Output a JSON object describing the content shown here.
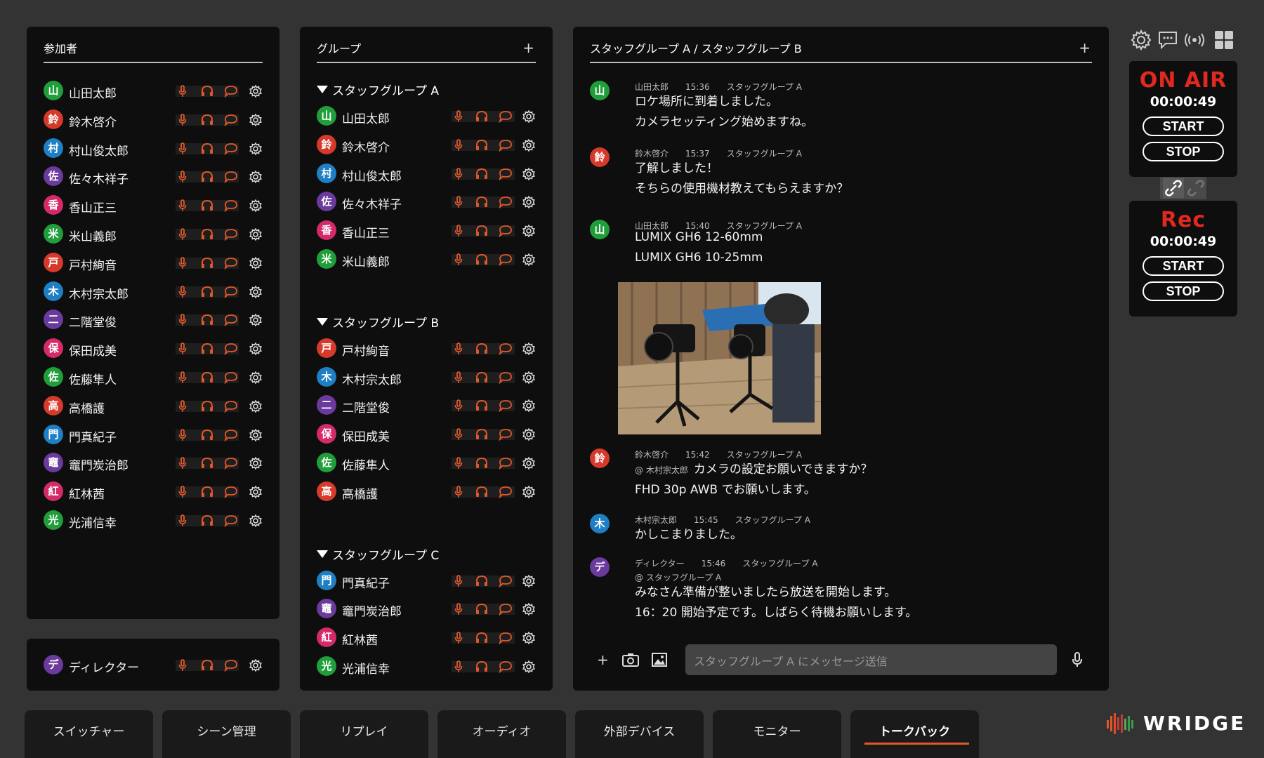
{
  "colors": {
    "accent": "#e0582a",
    "on_air": "#e0291f",
    "panel": "#0e0e0e",
    "bg": "#333333"
  },
  "participants": {
    "title": "参加者",
    "items": [
      {
        "initial": "山",
        "name": "山田太郎",
        "color": "#1f9e3a"
      },
      {
        "initial": "鈴",
        "name": "鈴木啓介",
        "color": "#d63a2a"
      },
      {
        "initial": "村",
        "name": "村山俊太郎",
        "color": "#1f7fc4"
      },
      {
        "initial": "佐",
        "name": "佐々木祥子",
        "color": "#6a3a9c"
      },
      {
        "initial": "香",
        "name": "香山正三",
        "color": "#d42a6a"
      },
      {
        "initial": "米",
        "name": "米山義郎",
        "color": "#1f9e3a"
      },
      {
        "initial": "戸",
        "name": "戸村絢音",
        "color": "#d63a2a"
      },
      {
        "initial": "木",
        "name": "木村宗太郎",
        "color": "#1f7fc4"
      },
      {
        "initial": "二",
        "name": "二階堂俊",
        "color": "#6a3a9c"
      },
      {
        "initial": "保",
        "name": "保田成美",
        "color": "#d42a6a"
      },
      {
        "initial": "佐",
        "name": "佐藤隼人",
        "color": "#1f9e3a"
      },
      {
        "initial": "高",
        "name": "高橋護",
        "color": "#d63a2a"
      },
      {
        "initial": "門",
        "name": "門真紀子",
        "color": "#1f7fc4"
      },
      {
        "initial": "竈",
        "name": "竈門炭治郎",
        "color": "#6a3a9c"
      },
      {
        "initial": "紅",
        "name": "紅林茜",
        "color": "#d42a6a"
      },
      {
        "initial": "光",
        "name": "光浦信幸",
        "color": "#1f9e3a"
      }
    ]
  },
  "director": {
    "initial": "デ",
    "name": "ディレクター",
    "color": "#6a3a9c"
  },
  "groups": {
    "title": "グループ",
    "add": "+",
    "list": [
      {
        "name": "スタッフグループ A",
        "members": [
          {
            "initial": "山",
            "name": "山田太郎",
            "color": "#1f9e3a"
          },
          {
            "initial": "鈴",
            "name": "鈴木啓介",
            "color": "#d63a2a"
          },
          {
            "initial": "村",
            "name": "村山俊太郎",
            "color": "#1f7fc4"
          },
          {
            "initial": "佐",
            "name": "佐々木祥子",
            "color": "#6a3a9c"
          },
          {
            "initial": "香",
            "name": "香山正三",
            "color": "#d42a6a"
          },
          {
            "initial": "米",
            "name": "米山義郎",
            "color": "#1f9e3a"
          }
        ]
      },
      {
        "name": "スタッフグループ B",
        "members": [
          {
            "initial": "戸",
            "name": "戸村絢音",
            "color": "#d63a2a"
          },
          {
            "initial": "木",
            "name": "木村宗太郎",
            "color": "#1f7fc4"
          },
          {
            "initial": "二",
            "name": "二階堂俊",
            "color": "#6a3a9c"
          },
          {
            "initial": "保",
            "name": "保田成美",
            "color": "#d42a6a"
          },
          {
            "initial": "佐",
            "name": "佐藤隼人",
            "color": "#1f9e3a"
          },
          {
            "initial": "高",
            "name": "高橋護",
            "color": "#d63a2a"
          }
        ]
      },
      {
        "name": "スタッフグループ C",
        "members": [
          {
            "initial": "門",
            "name": "門真紀子",
            "color": "#1f7fc4"
          },
          {
            "initial": "竈",
            "name": "竈門炭治郎",
            "color": "#6a3a9c"
          },
          {
            "initial": "紅",
            "name": "紅林茜",
            "color": "#d42a6a"
          },
          {
            "initial": "光",
            "name": "光浦信幸",
            "color": "#1f9e3a"
          }
        ]
      }
    ]
  },
  "chat": {
    "title": "スタッフグループ A / スタッフグループ B",
    "add": "+",
    "messages": [
      {
        "initial": "山",
        "color": "#1f9e3a",
        "sender": "山田太郎",
        "time": "15:36",
        "group": "スタッフグループ A",
        "lines": [
          "ロケ場所に到着しました。",
          "カメラセッティング始めますね。"
        ]
      },
      {
        "initial": "鈴",
        "color": "#d63a2a",
        "sender": "鈴木啓介",
        "time": "15:37",
        "group": "スタッフグループ A",
        "lines": [
          "了解しました！",
          "そちらの使用機材教えてもらえますか？"
        ]
      },
      {
        "initial": "山",
        "color": "#1f9e3a",
        "sender": "山田太郎",
        "time": "15:40",
        "group": "スタッフグループ A",
        "lines": [
          "LUMIX GH6 12-60mm",
          "LUMIX GH6 10-25mm"
        ]
      },
      {
        "initial": "鈴",
        "color": "#d63a2a",
        "sender": "鈴木啓介",
        "time": "15:42",
        "group": "スタッフグループ A",
        "mention": "@ 木村宗太郎",
        "lines": [
          "カメラの設定お願いできますか？",
          "FHD 30p AWB でお願いします。"
        ]
      },
      {
        "initial": "木",
        "color": "#1f7fc4",
        "sender": "木村宗太郎",
        "time": "15:45",
        "group": "スタッフグループ A",
        "lines": [
          "かしこまりました。"
        ]
      },
      {
        "initial": "デ",
        "color": "#6a3a9c",
        "sender": "ディレクター",
        "time": "15:46",
        "group": "スタッフグループ A",
        "mention": "@ スタッフグループ A",
        "lines": [
          "みなさん準備が整いましたら放送を開始します。",
          "16：20 開始予定です。しばらく待機お願いします。"
        ]
      }
    ],
    "input_placeholder": "スタッフグループ A にメッセージ送信"
  },
  "onair": {
    "title": "ON AIR",
    "time": "00:00:49",
    "start": "START",
    "stop": "STOP"
  },
  "rec": {
    "title": "Rec",
    "time": "00:00:49",
    "start": "START",
    "stop": "STOP"
  },
  "tabs": [
    "スイッチャー",
    "シーン管理",
    "リプレイ",
    "オーディオ",
    "外部デバイス",
    "モニター",
    "トークバック"
  ],
  "active_tab": "トークバック",
  "brand": "WRIDGE"
}
